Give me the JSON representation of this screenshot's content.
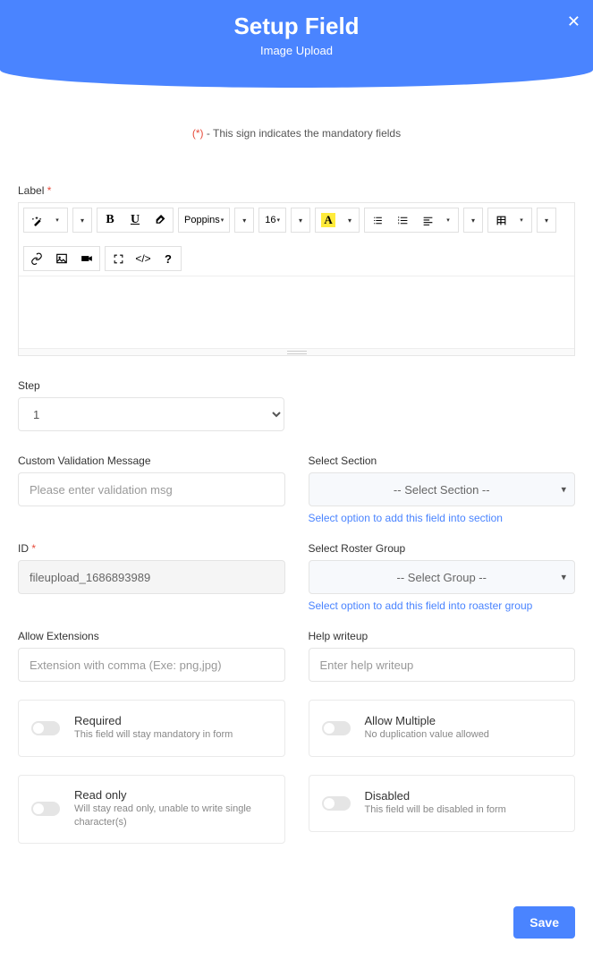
{
  "header": {
    "title": "Setup Field",
    "subtitle": "Image Upload"
  },
  "mandatory_note": {
    "marker": "(*)",
    "text": " - This sign indicates the mandatory fields"
  },
  "labels": {
    "label": "Label ",
    "step": "Step",
    "custom_validation": "Custom Validation Message",
    "select_section": "Select Section",
    "id": "ID ",
    "select_roster": "Select Roster Group",
    "allow_ext": "Allow Extensions",
    "help_writeup": "Help writeup"
  },
  "editor": {
    "font_family": "Poppins",
    "font_size": "16"
  },
  "step": {
    "value": "1"
  },
  "custom_validation": {
    "placeholder": "Please enter validation msg"
  },
  "select_section": {
    "placeholder": "-- Select Section --",
    "helper": "Select option to add this field into section"
  },
  "id_field": {
    "value": "fileupload_1686893989"
  },
  "select_roster": {
    "placeholder": "-- Select Group --",
    "helper": "Select option to add this field into roaster group"
  },
  "allow_ext": {
    "placeholder": "Extension with comma (Exe: png,jpg)"
  },
  "help_writeup": {
    "placeholder": "Enter help writeup"
  },
  "toggles": {
    "required": {
      "label": "Required",
      "desc": "This field will stay mandatory in form"
    },
    "allow_multiple": {
      "label": "Allow Multiple",
      "desc": "No duplication value allowed"
    },
    "read_only": {
      "label": "Read only",
      "desc": "Will stay read only, unable to write single character(s)"
    },
    "disabled": {
      "label": "Disabled",
      "desc": "This field will be disabled in form"
    }
  },
  "save_button": "Save"
}
